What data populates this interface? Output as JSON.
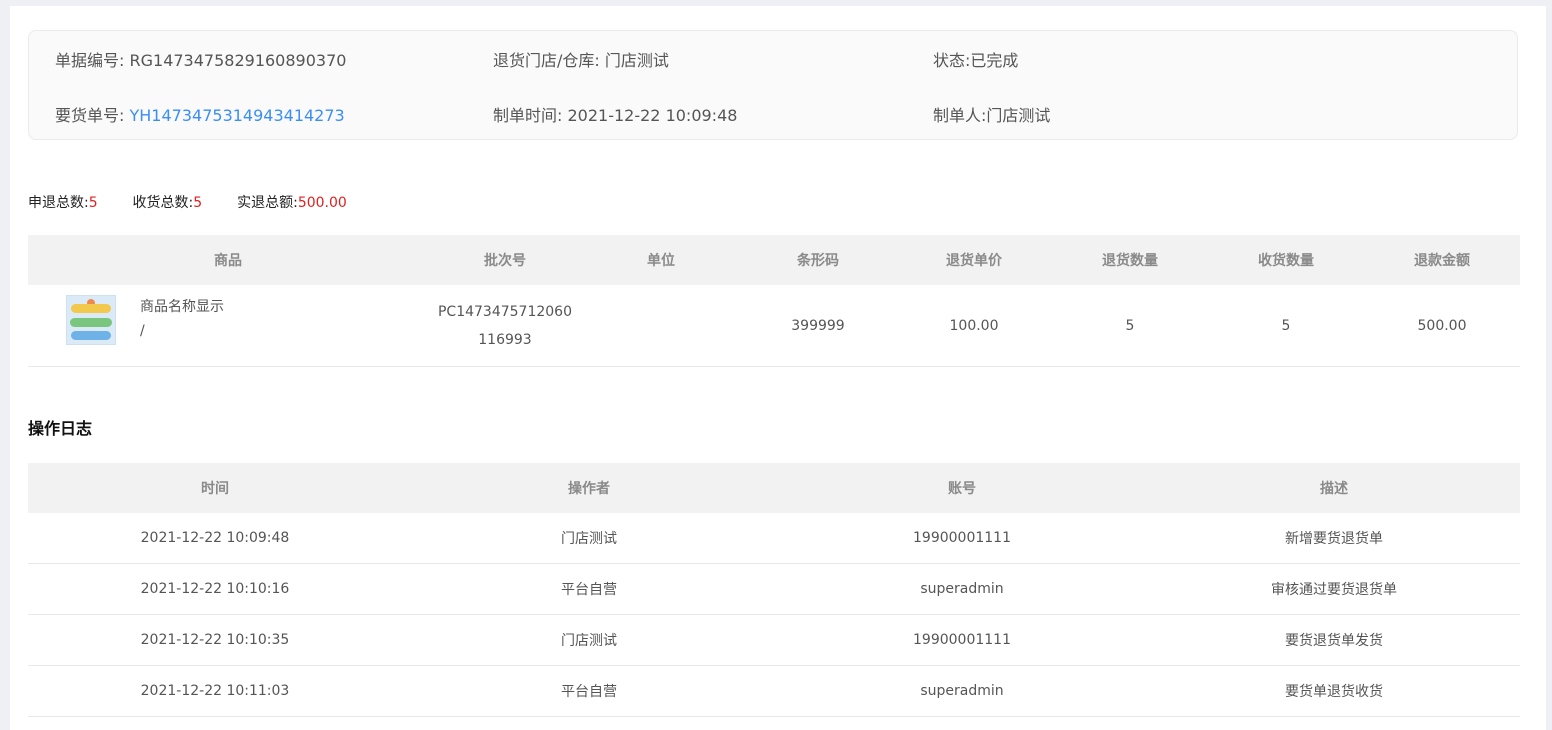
{
  "info": {
    "doc_no_label": "单据编号:",
    "doc_no": "RG1473475829160890370",
    "store_label": "退货门店/仓库:",
    "store": "门店测试",
    "status_label": "状态:",
    "status": "已完成",
    "order_no_label": "要货单号:",
    "order_no": "YH1473475314943414273",
    "time_label": "制单时间:",
    "time": "2021-12-22 10:09:48",
    "creator_label": "制单人:",
    "creator": "门店测试"
  },
  "summary": {
    "apply_label": "申退总数:",
    "apply": "5",
    "received_label": "收货总数:",
    "received": "5",
    "amount_label": "实退总额:",
    "amount": "500.00"
  },
  "goods_table": {
    "headers": [
      "商品",
      "批次号",
      "单位",
      "条形码",
      "退货单价",
      "退货数量",
      "收货数量",
      "退款金额"
    ],
    "rows": [
      {
        "name": "商品名称显示",
        "spec": "/",
        "batch_line1": "PC1473475712060",
        "batch_line2": "116993",
        "unit": "",
        "barcode": "399999",
        "price": "100.00",
        "return_qty": "5",
        "received_qty": "5",
        "refund": "500.00"
      }
    ]
  },
  "log": {
    "title": "操作日志",
    "headers": [
      "时间",
      "操作者",
      "账号",
      "描述"
    ],
    "rows": [
      {
        "time": "2021-12-22 10:09:48",
        "operator": "门店测试",
        "account": "19900001111",
        "desc": "新增要货退货单"
      },
      {
        "time": "2021-12-22 10:10:16",
        "operator": "平台自营",
        "account": "superadmin",
        "desc": "审核通过要货退货单"
      },
      {
        "time": "2021-12-22 10:10:35",
        "operator": "门店测试",
        "account": "19900001111",
        "desc": "要货退货单发货"
      },
      {
        "time": "2021-12-22 10:11:03",
        "operator": "平台自营",
        "account": "superadmin",
        "desc": "要货单退货收货"
      }
    ]
  },
  "colors": {
    "link": "#3a8ef6",
    "highlight": "#e02020",
    "header_bg": "#f2f2f2"
  }
}
